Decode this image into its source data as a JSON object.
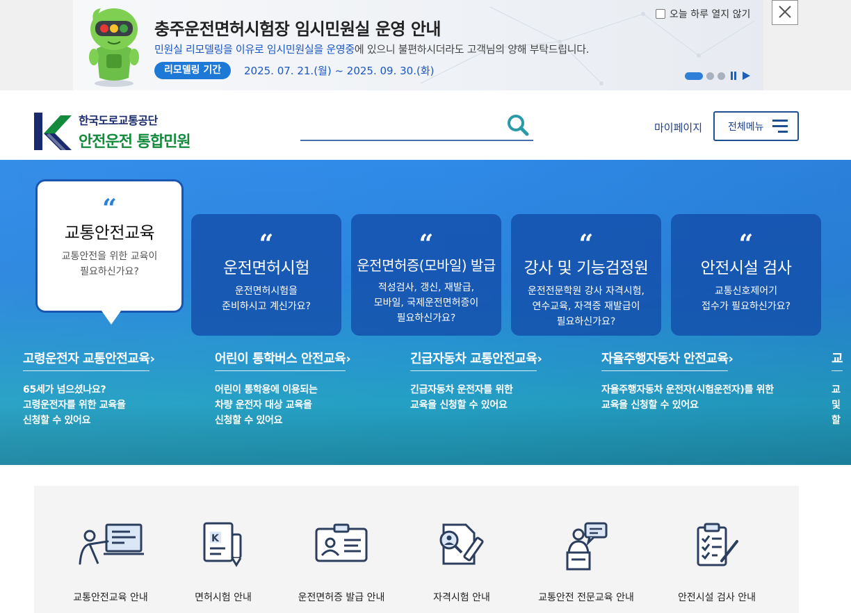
{
  "popup": {
    "title": "충주운전면허시험장 임시민원실 운영 안내",
    "desc_highlight_1": "민원실 리모델링을 이유로 임시민원실을 운영중",
    "desc_rest": "에 있으니 불편하시더라도 고객님의 양해 부탁드립니다.",
    "period_label": "리모델링 기간",
    "period_dates": "2025. 07. 21.(월) ~ 2025. 09. 30.(화)",
    "close_today_label": "오늘 하루 열지 않기",
    "slide_count": 3,
    "slide_active": 1
  },
  "header": {
    "org_name": "한국도로교통공단",
    "service_name": "안전운전 통합민원",
    "search_placeholder": "",
    "mypage_label": "마이페이지",
    "allmenu_label": "전체메뉴"
  },
  "hero": {
    "cards": [
      {
        "title": "교통안전교육",
        "desc": "교통안전을 위한 교육이\n필요하신가요?"
      },
      {
        "title": "운전면허시험",
        "desc": "운전면허시험을\n준비하시고 계신가요?"
      },
      {
        "title": "운전면허증(모바일) 발급",
        "desc": "적성검사, 갱신, 재발급,\n모바일, 국제운전면허증이\n필요하신가요?"
      },
      {
        "title": "강사 및 기능검정원",
        "desc": "운전전문학원 강사 자격시험,\n연수교육, 자격증 재발급이\n필요하신가요?"
      },
      {
        "title": "안전시설 검사",
        "desc": "교통신호제어기\n접수가 필요하신가요?"
      }
    ],
    "subs": [
      {
        "title": "고령운전자 교통안전교육",
        "desc": "65세가 넘으셨나요?\n고령운전자를 위한 교육을\n신청할 수 있어요"
      },
      {
        "title": "어린이 통학버스 안전교육",
        "desc": "어린이 통학용에 이용되는\n차량 운전자 대상 교육을\n신청할 수 있어요"
      },
      {
        "title": "긴급자동차 교통안전교육",
        "desc": "긴급자동차 운전자를 위한\n교육을 신청할 수 있어요"
      },
      {
        "title": "자율주행자동차 안전교육",
        "desc": "자율주행자동차 운전자(시험운전자)를 위한\n교육을 신청할 수 있어요"
      },
      {
        "title": "교",
        "desc": "교\n및\n할"
      }
    ]
  },
  "quick": {
    "items": [
      {
        "label": "교통안전교육 안내",
        "icon": "presentation-icon"
      },
      {
        "label": "면허시험 안내",
        "icon": "license-pen-icon"
      },
      {
        "label": "운전면허증 발급 안내",
        "icon": "id-card-icon"
      },
      {
        "label": "자격시험 안내",
        "icon": "document-search-icon"
      },
      {
        "label": "교통안전 전문교육 안내",
        "icon": "lecturer-icon"
      },
      {
        "label": "안전시설 검사 안내",
        "icon": "checklist-icon"
      }
    ]
  },
  "colors": {
    "brand_navy": "#1a2b6d",
    "brand_green": "#138a3c",
    "accent_blue": "#1d78d6",
    "hero_blue": "#2f8ae8",
    "hero_teal": "#1d86a0"
  }
}
